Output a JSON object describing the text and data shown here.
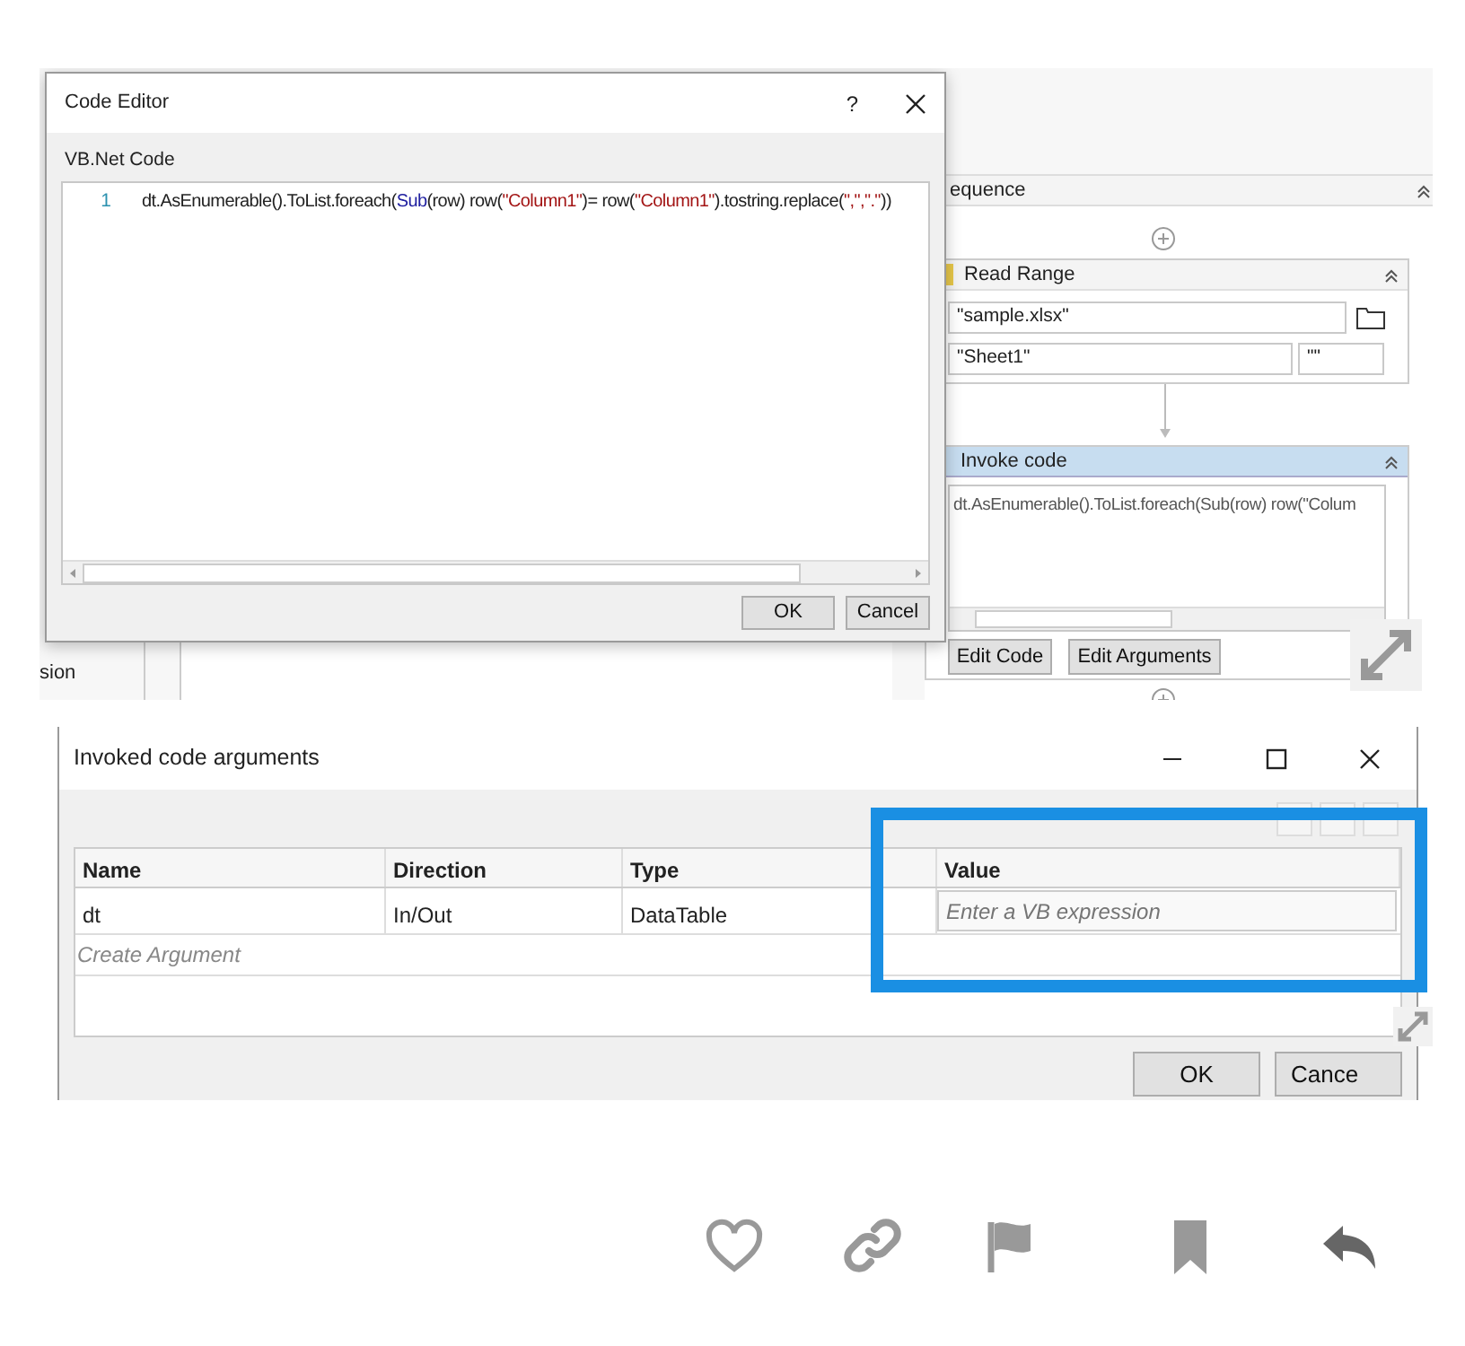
{
  "designer": {
    "edge_text": "sion",
    "sequence": {
      "title": "equence"
    },
    "read_range": {
      "title": "Read Range",
      "file": "\"sample.xlsx\"",
      "sheet": "\"Sheet1\"",
      "range": "\"\""
    },
    "invoke_code": {
      "title": "Invoke code",
      "selected": true,
      "code": "dt.AsEnumerable().ToList.foreach(Sub(row) row(\"Colum",
      "buttons": [
        "Edit Code",
        "Edit Arguments"
      ]
    }
  },
  "code_editor": {
    "title": "Code Editor",
    "help": "?",
    "label": "VB.Net Code",
    "lines": [
      {
        "number": "1",
        "tokens": [
          {
            "kind": "plain",
            "text": "dt.AsEnumerable().ToList.foreach("
          },
          {
            "kind": "keyword",
            "text": "Sub"
          },
          {
            "kind": "plain",
            "text": "(row) row("
          },
          {
            "kind": "string",
            "text": "\"Column1\""
          },
          {
            "kind": "plain",
            "text": ")= row("
          },
          {
            "kind": "string",
            "text": "\"Column1\""
          },
          {
            "kind": "plain",
            "text": ").tostring.replace("
          },
          {
            "kind": "string",
            "text": "\",\",\".\""
          },
          {
            "kind": "plain",
            "text": "))"
          }
        ]
      }
    ],
    "buttons": [
      "OK",
      "Cancel"
    ]
  },
  "arguments_dialog": {
    "title": "Invoked code arguments",
    "columns": [
      "Name",
      "Direction",
      "Type",
      "Value"
    ],
    "rows": [
      {
        "name": "dt",
        "direction": "In/Out",
        "type": "DataTable",
        "value_placeholder": "Enter a VB expression"
      }
    ],
    "create_placeholder": "Create Argument",
    "buttons": [
      "OK",
      "Cance"
    ]
  },
  "post_actions": [
    {
      "kind": "like"
    },
    {
      "kind": "link"
    },
    {
      "kind": "flag"
    },
    {
      "kind": "bookmark"
    },
    {
      "kind": "reply"
    }
  ]
}
